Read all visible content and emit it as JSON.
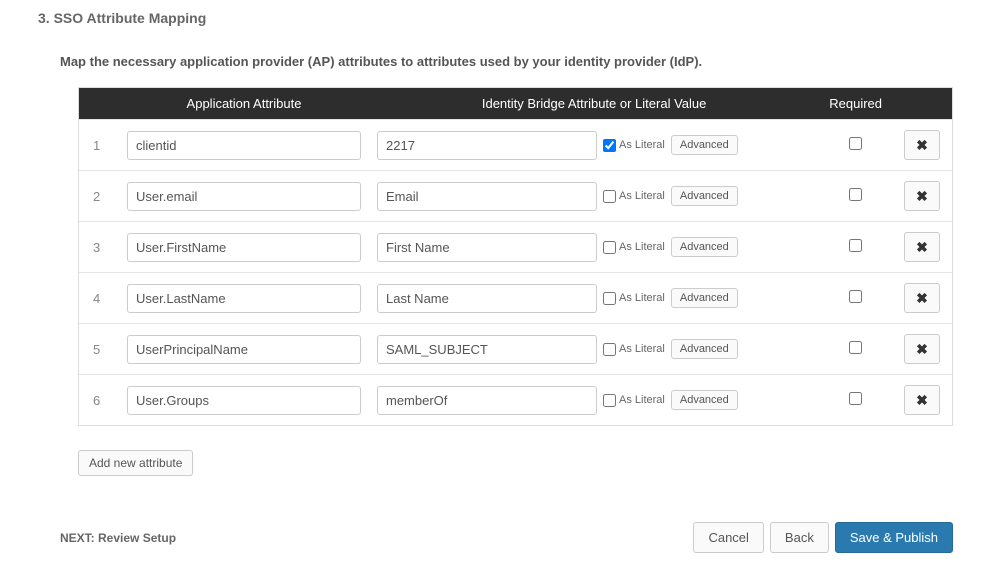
{
  "section": {
    "number": "3.",
    "title": "SSO Attribute Mapping",
    "description": "Map the necessary application provider (AP) attributes to attributes used by your identity provider (IdP)."
  },
  "table": {
    "headers": {
      "app_attribute": "Application Attribute",
      "idp_attribute": "Identity Bridge Attribute or Literal Value",
      "required": "Required"
    },
    "as_literal_label": "As Literal",
    "advanced_label": "Advanced",
    "rows": [
      {
        "num": "1",
        "app": "clientid",
        "idp": "2217",
        "as_literal": true,
        "required": false
      },
      {
        "num": "2",
        "app": "User.email",
        "idp": "Email",
        "as_literal": false,
        "required": false
      },
      {
        "num": "3",
        "app": "User.FirstName",
        "idp": "First Name",
        "as_literal": false,
        "required": false
      },
      {
        "num": "4",
        "app": "User.LastName",
        "idp": "Last Name",
        "as_literal": false,
        "required": false
      },
      {
        "num": "5",
        "app": "UserPrincipalName",
        "idp": "SAML_SUBJECT",
        "as_literal": false,
        "required": false
      },
      {
        "num": "6",
        "app": "User.Groups",
        "idp": "memberOf",
        "as_literal": false,
        "required": false
      }
    ]
  },
  "buttons": {
    "add_new_attribute": "Add new attribute",
    "cancel": "Cancel",
    "back": "Back",
    "save_publish": "Save & Publish"
  },
  "footer": {
    "next_label": "NEXT: Review Setup"
  }
}
